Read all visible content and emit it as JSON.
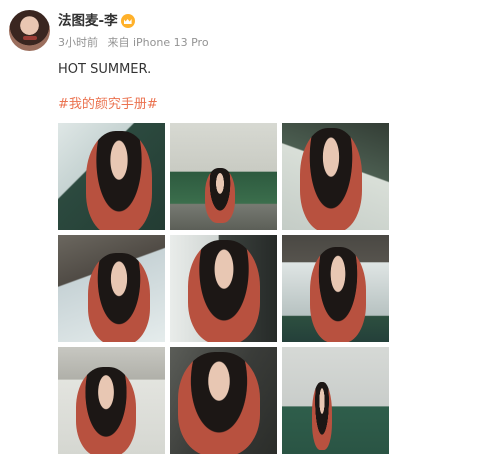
{
  "post": {
    "username": "法图麦-李",
    "badge_icon": "vip-crown-icon",
    "time": "3小时前",
    "source": "来自 iPhone 13 Pro",
    "text": "HOT SUMMER.",
    "hashtag": "#我的颜究手册#"
  },
  "colors": {
    "hashtag": "#eb7350",
    "meta": "#939393",
    "username": "#333333"
  },
  "photos": [
    {
      "scene": "window-portrait"
    },
    {
      "scene": "seated-bench"
    },
    {
      "scene": "leaning-window"
    },
    {
      "scene": "window-ferry"
    },
    {
      "scene": "profile-closeup"
    },
    {
      "scene": "sitting-railing"
    },
    {
      "scene": "arm-raised"
    },
    {
      "scene": "face-closeup"
    },
    {
      "scene": "cabin-leg-raised"
    }
  ]
}
